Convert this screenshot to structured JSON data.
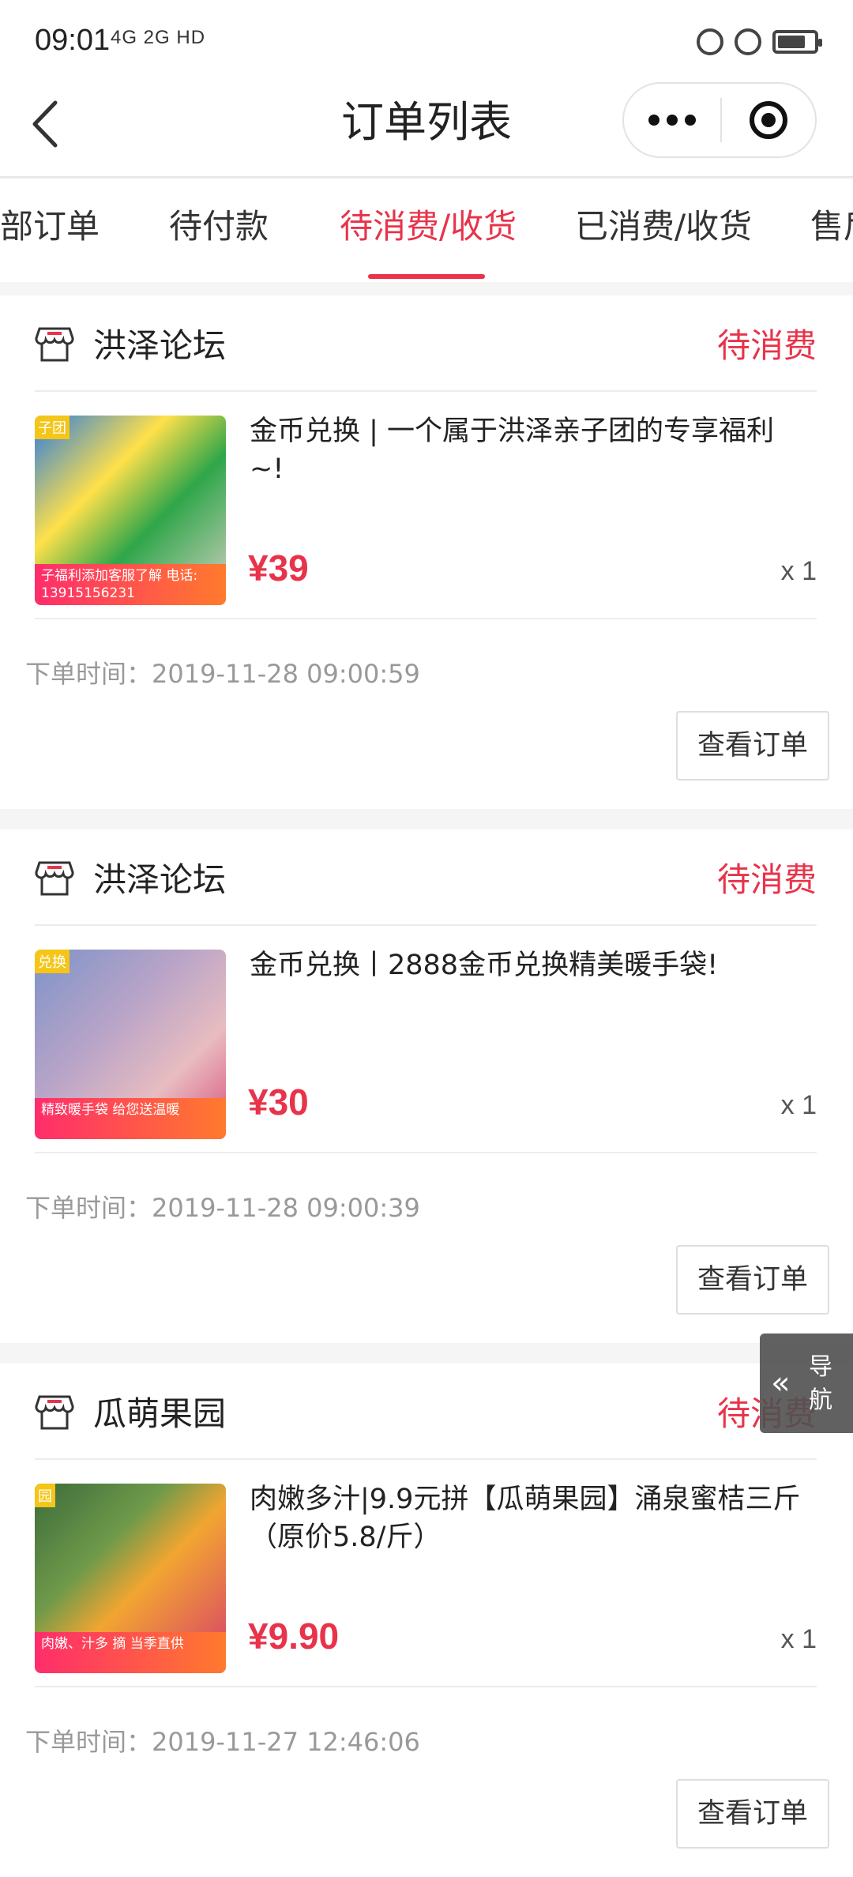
{
  "status_bar": {
    "time": "09:01",
    "network": "4G 2G HD"
  },
  "nav": {
    "title": "订单列表"
  },
  "tabs": [
    {
      "label": "部订单"
    },
    {
      "label": "待付款"
    },
    {
      "label": "待消费/收货"
    },
    {
      "label": "已消费/收货"
    },
    {
      "label": "售后"
    }
  ],
  "orders": [
    {
      "shop": "洪泽论坛",
      "status": "待消费",
      "product_title": "金币兑换 | 一个属于洪泽亲子团的专享福利~!",
      "price": "¥39",
      "quantity": "x 1",
      "order_time": "下单时间：2019-11-28 09:00:59",
      "button": "查看订单",
      "thumb_tag": "子团",
      "thumb_band": "子福利添加客服了解 电话: 13915156231"
    },
    {
      "shop": "洪泽论坛",
      "status": "待消费",
      "product_title": "金币兑换丨2888金币兑换精美暖手袋!",
      "price": "¥30",
      "quantity": "x 1",
      "order_time": "下单时间：2019-11-28 09:00:39",
      "button": "查看订单",
      "thumb_tag": "兑换",
      "thumb_band": "精致暖手袋 给您送温暖"
    },
    {
      "shop": "瓜萌果园",
      "status": "待消费",
      "product_title": "肉嫩多汁|9.9元拼【瓜萌果园】涌泉蜜桔三斤（原价5.8/斤）",
      "price": "¥9.90",
      "quantity": "x 1",
      "order_time": "下单时间：2019-11-27 12:46:06",
      "button": "查看订单",
      "thumb_tag": "园",
      "thumb_band": "肉嫩、汁多 摘 当季直供"
    }
  ],
  "float_nav": {
    "label": "导航"
  }
}
